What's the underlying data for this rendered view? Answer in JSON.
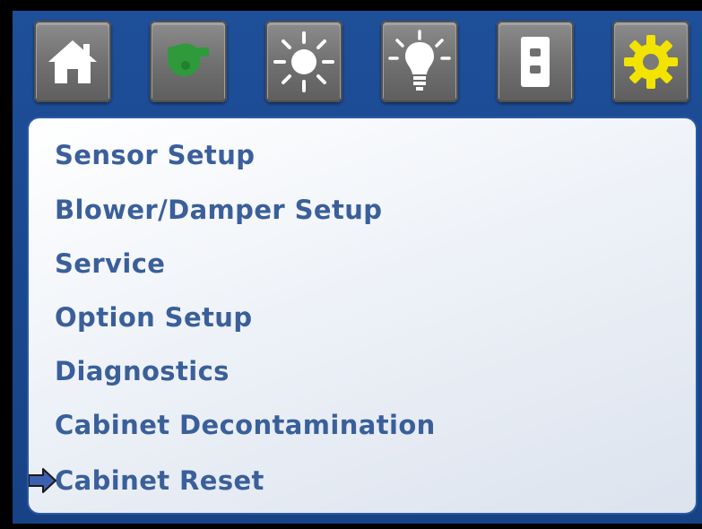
{
  "toolbar": {
    "buttons": [
      {
        "name": "home",
        "icon": "home-icon"
      },
      {
        "name": "blower",
        "icon": "blower-icon"
      },
      {
        "name": "uv-light",
        "icon": "sun-icon"
      },
      {
        "name": "light",
        "icon": "light-bulb-icon"
      },
      {
        "name": "outlet",
        "icon": "outlet-icon"
      },
      {
        "name": "settings",
        "icon": "gear-icon",
        "active": true
      }
    ]
  },
  "menu": {
    "items": [
      {
        "label": "Sensor Setup"
      },
      {
        "label": "Blower/Damper Setup"
      },
      {
        "label": "Service"
      },
      {
        "label": "Option Setup"
      },
      {
        "label": "Diagnostics"
      },
      {
        "label": "Cabinet Decontamination"
      },
      {
        "label": "Cabinet Reset",
        "selected": true
      }
    ],
    "selector_icon": "right-arrow-icon"
  },
  "colors": {
    "background": "#1e4f99",
    "menu_text": "#3a5f9a",
    "blower_icon": "#2e9a3a",
    "gear_icon": "#f2e400",
    "button_face": "#7a7a7a",
    "arrow": "#3d5fb0"
  }
}
